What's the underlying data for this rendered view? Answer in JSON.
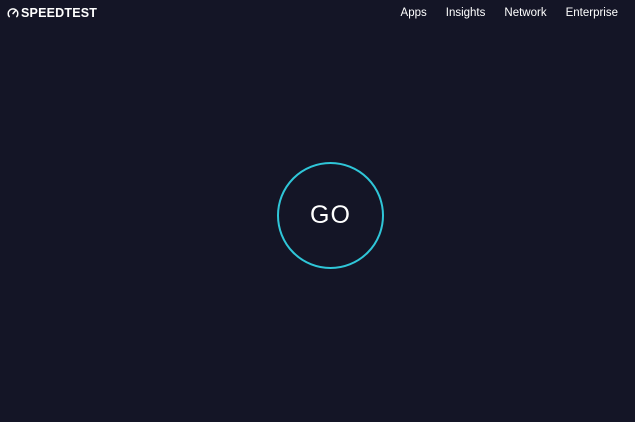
{
  "header": {
    "logo_text": "SPEEDTEST",
    "logo_icon": "gauge-icon",
    "nav": [
      {
        "label": "Apps"
      },
      {
        "label": "Insights"
      },
      {
        "label": "Network"
      },
      {
        "label": "Enterprise"
      }
    ]
  },
  "main": {
    "go_label": "GO"
  },
  "colors": {
    "background": "#141526",
    "ring": "#2fc6d8",
    "text": "#ffffff"
  }
}
